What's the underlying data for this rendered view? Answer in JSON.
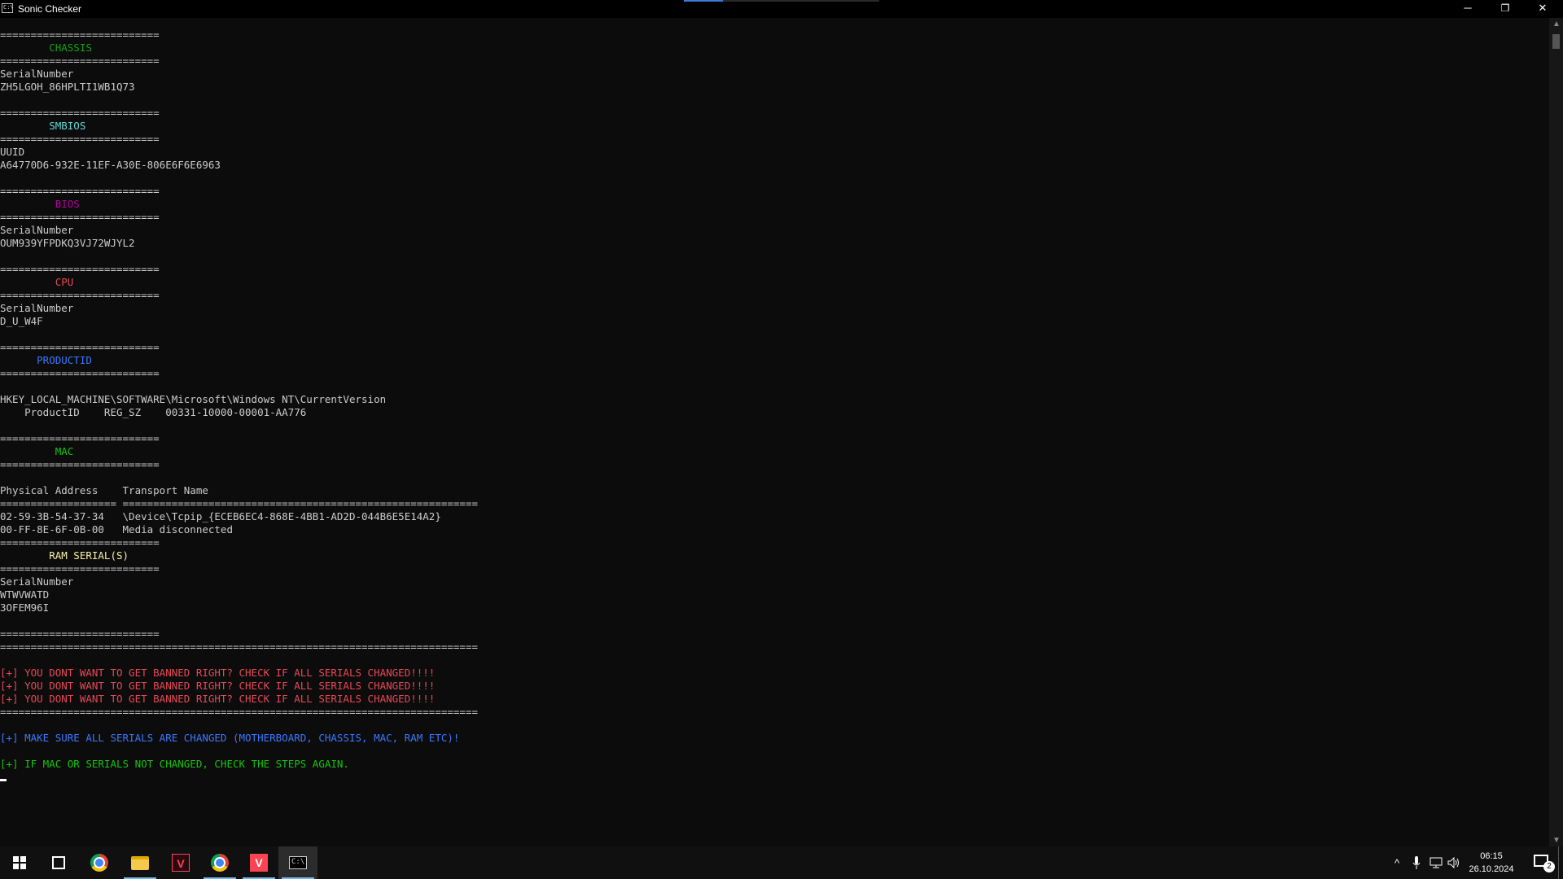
{
  "window": {
    "title": "Sonic Checker",
    "icon_text": "C:\\",
    "icon": "console-icon"
  },
  "window_controls": {
    "minimize": "─",
    "restore": "❐",
    "close": "✕"
  },
  "console_lines": [
    {
      "text": "==========================",
      "color": "default"
    },
    {
      "text": "        CHASSIS",
      "color": "green"
    },
    {
      "text": "==========================",
      "color": "default"
    },
    {
      "text": "SerialNumber",
      "color": "default"
    },
    {
      "text": "ZH5LGOH_86HPLTI1WB1Q73",
      "color": "default"
    },
    {
      "text": "",
      "color": "default"
    },
    {
      "text": "==========================",
      "color": "default"
    },
    {
      "text": "        SMBIOS",
      "color": "teal"
    },
    {
      "text": "==========================",
      "color": "default"
    },
    {
      "text": "UUID",
      "color": "default"
    },
    {
      "text": "A64770D6-932E-11EF-A30E-806E6F6E6963",
      "color": "default"
    },
    {
      "text": "",
      "color": "default"
    },
    {
      "text": "==========================",
      "color": "default"
    },
    {
      "text": "         BIOS",
      "color": "magenta"
    },
    {
      "text": "==========================",
      "color": "default"
    },
    {
      "text": "SerialNumber",
      "color": "default"
    },
    {
      "text": "OUM939YFPDKQ3VJ72WJYL2",
      "color": "default"
    },
    {
      "text": "",
      "color": "default"
    },
    {
      "text": "==========================",
      "color": "default"
    },
    {
      "text": "         CPU",
      "color": "red"
    },
    {
      "text": "==========================",
      "color": "default"
    },
    {
      "text": "SerialNumber",
      "color": "default"
    },
    {
      "text": "D_U_W4F",
      "color": "default"
    },
    {
      "text": "",
      "color": "default"
    },
    {
      "text": "==========================",
      "color": "default"
    },
    {
      "text": "      PRODUCTID",
      "color": "blue"
    },
    {
      "text": "==========================",
      "color": "default"
    },
    {
      "text": "",
      "color": "default"
    },
    {
      "text": "HKEY_LOCAL_MACHINE\\SOFTWARE\\Microsoft\\Windows NT\\CurrentVersion",
      "color": "default"
    },
    {
      "text": "    ProductID    REG_SZ    00331-10000-00001-AA776",
      "color": "default"
    },
    {
      "text": "",
      "color": "default"
    },
    {
      "text": "==========================",
      "color": "default"
    },
    {
      "text": "         MAC",
      "color": "lgreen"
    },
    {
      "text": "==========================",
      "color": "default"
    },
    {
      "text": "",
      "color": "default"
    },
    {
      "text": "Physical Address    Transport Name",
      "color": "default"
    },
    {
      "text": "=================== ==========================================================",
      "color": "default"
    },
    {
      "text": "02-59-3B-54-37-34   \\Device\\Tcpip_{ECEB6EC4-868E-4BB1-AD2D-044B6E5E14A2}",
      "color": "default"
    },
    {
      "text": "00-FF-8E-6F-0B-00   Media disconnected",
      "color": "default"
    },
    {
      "text": "==========================",
      "color": "default"
    },
    {
      "text": "        RAM SERIAL(S)",
      "color": "yellow"
    },
    {
      "text": "==========================",
      "color": "default"
    },
    {
      "text": "SerialNumber",
      "color": "default"
    },
    {
      "text": "WTWVWATD",
      "color": "default"
    },
    {
      "text": "3OFEM96I",
      "color": "default"
    },
    {
      "text": "",
      "color": "default"
    },
    {
      "text": "==========================",
      "color": "default"
    },
    {
      "text": "==============================================================================",
      "color": "default"
    },
    {
      "text": "",
      "color": "default"
    },
    {
      "text": "[+] YOU DONT WANT TO GET BANNED RIGHT? CHECK IF ALL SERIALS CHANGED!!!!",
      "color": "red"
    },
    {
      "text": "[+] YOU DONT WANT TO GET BANNED RIGHT? CHECK IF ALL SERIALS CHANGED!!!!",
      "color": "red"
    },
    {
      "text": "[+] YOU DONT WANT TO GET BANNED RIGHT? CHECK IF ALL SERIALS CHANGED!!!!",
      "color": "red"
    },
    {
      "text": "==============================================================================",
      "color": "default"
    },
    {
      "text": "",
      "color": "default"
    },
    {
      "text": "[+] MAKE SURE ALL SERIALS ARE CHANGED (MOTHERBOARD, CHASSIS, MAC, RAM ETC)!",
      "color": "blue"
    },
    {
      "text": "",
      "color": "default"
    },
    {
      "text": "[+] IF MAC OR SERIALS NOT CHANGED, CHECK THE STEPS AGAIN.",
      "color": "lgreen"
    }
  ],
  "colors": {
    "default": "#cccccc",
    "green": "#13a10e",
    "teal": "#61d6d6",
    "magenta": "#b4009e",
    "red": "#e74856",
    "blue": "#3b78ff",
    "lgreen": "#16c60c",
    "yellow": "#f9f1a5",
    "taskbar_active_indicator": "#76b9ed"
  },
  "taskbar": {
    "items": [
      {
        "name": "start-button",
        "icon": "windows-icon"
      },
      {
        "name": "task-view-button",
        "icon": "task-view-icon"
      },
      {
        "name": "taskbar-chrome",
        "icon": "chrome-icon"
      },
      {
        "name": "taskbar-file-explorer",
        "icon": "folder-icon",
        "active": true
      },
      {
        "name": "taskbar-valorant",
        "icon": "valorant-icon"
      },
      {
        "name": "taskbar-chrome-2",
        "icon": "chrome-icon",
        "active": true
      },
      {
        "name": "taskbar-valorant-2",
        "icon": "valorant-icon",
        "active": true
      },
      {
        "name": "taskbar-console",
        "icon": "console-icon",
        "active": true,
        "current": true
      }
    ],
    "tray": {
      "chevron": "^",
      "icons": [
        "microphone-icon",
        "network-icon",
        "volume-icon"
      ]
    },
    "clock": {
      "time": "06:15",
      "date": "26.10.2024"
    },
    "notifications": {
      "count": "2"
    }
  }
}
